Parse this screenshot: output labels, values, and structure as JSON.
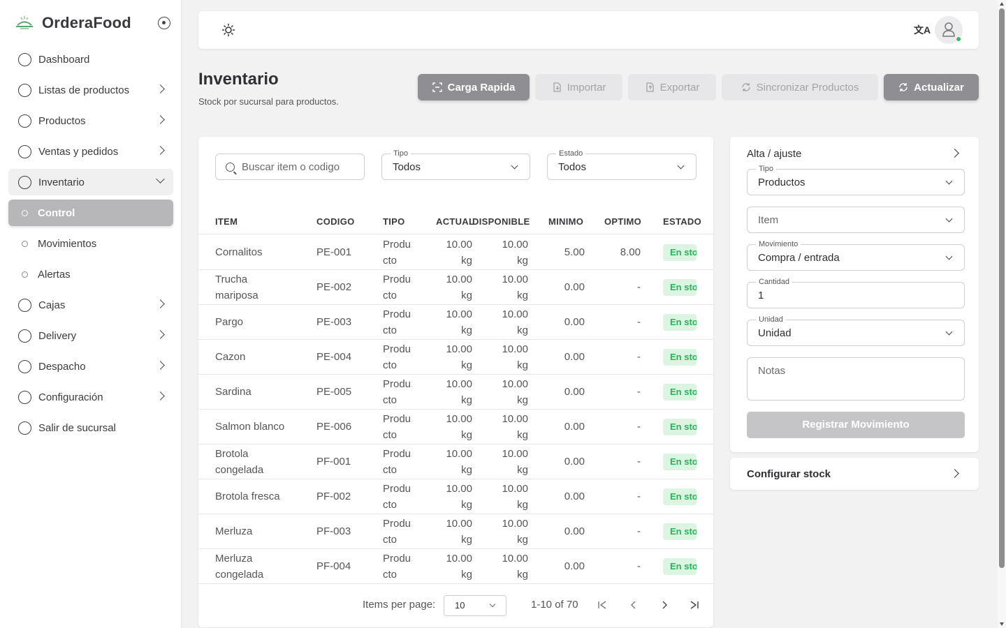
{
  "brand": {
    "name": "OrderaFood"
  },
  "sidebar": {
    "items": [
      {
        "label": "Dashboard",
        "kind": "ring",
        "chevron": "none"
      },
      {
        "label": "Listas de productos",
        "kind": "ring",
        "chevron": "right"
      },
      {
        "label": "Productos",
        "kind": "ring",
        "chevron": "right"
      },
      {
        "label": "Ventas y pedidos",
        "kind": "ring",
        "chevron": "right"
      },
      {
        "label": "Inventario",
        "kind": "ring",
        "chevron": "down",
        "state": "open"
      },
      {
        "label": "Control",
        "kind": "dot",
        "chevron": "none",
        "state": "active"
      },
      {
        "label": "Movimientos",
        "kind": "dot",
        "chevron": "none"
      },
      {
        "label": "Alertas",
        "kind": "dot",
        "chevron": "none"
      },
      {
        "label": "Cajas",
        "kind": "ring",
        "chevron": "right"
      },
      {
        "label": "Delivery",
        "kind": "ring",
        "chevron": "right"
      },
      {
        "label": "Despacho",
        "kind": "ring",
        "chevron": "right"
      },
      {
        "label": "Configuración",
        "kind": "ring",
        "chevron": "right"
      },
      {
        "label": "Salir de sucursal",
        "kind": "ring",
        "chevron": "none"
      }
    ]
  },
  "topbar": {
    "theme_icon": "sun-icon",
    "translate_label": "文A"
  },
  "page": {
    "title": "Inventario",
    "subtitle": "Stock por sucursal para productos."
  },
  "actions": {
    "carga_rapida": "Carga Rapida",
    "importar": "Importar",
    "exportar": "Exportar",
    "sincronizar": "Sincronizar Productos",
    "actualizar": "Actualizar"
  },
  "filters": {
    "search_placeholder": "Buscar item o codigo",
    "tipo_label": "Tipo",
    "tipo_value": "Todos",
    "estado_label": "Estado",
    "estado_value": "Todos"
  },
  "table": {
    "headers": [
      "ITEM",
      "CODIGO",
      "TIPO",
      "ACTUAL",
      "DISPONIBLE",
      "MINIMO",
      "OPTIMO",
      "ESTADO"
    ],
    "rows": [
      {
        "item": [
          "Cornalitos"
        ],
        "codigo": "PE-001",
        "tipo": [
          "Produ",
          "cto"
        ],
        "actual": [
          "10.00",
          "kg"
        ],
        "disponible": [
          "10.00",
          "kg"
        ],
        "minimo": "5.00",
        "optimo": "8.00",
        "estado": "En stock"
      },
      {
        "item": [
          "Trucha",
          "mariposa"
        ],
        "codigo": "PE-002",
        "tipo": [
          "Produ",
          "cto"
        ],
        "actual": [
          "10.00",
          "kg"
        ],
        "disponible": [
          "10.00",
          "kg"
        ],
        "minimo": "0.00",
        "optimo": "-",
        "estado": "En stock"
      },
      {
        "item": [
          "Pargo"
        ],
        "codigo": "PE-003",
        "tipo": [
          "Produ",
          "cto"
        ],
        "actual": [
          "10.00",
          "kg"
        ],
        "disponible": [
          "10.00",
          "kg"
        ],
        "minimo": "0.00",
        "optimo": "-",
        "estado": "En stock"
      },
      {
        "item": [
          "Cazon"
        ],
        "codigo": "PE-004",
        "tipo": [
          "Produ",
          "cto"
        ],
        "actual": [
          "10.00",
          "kg"
        ],
        "disponible": [
          "10.00",
          "kg"
        ],
        "minimo": "0.00",
        "optimo": "-",
        "estado": "En stock"
      },
      {
        "item": [
          "Sardina"
        ],
        "codigo": "PE-005",
        "tipo": [
          "Produ",
          "cto"
        ],
        "actual": [
          "10.00",
          "kg"
        ],
        "disponible": [
          "10.00",
          "kg"
        ],
        "minimo": "0.00",
        "optimo": "-",
        "estado": "En stock"
      },
      {
        "item": [
          "Salmon blanco"
        ],
        "codigo": "PE-006",
        "tipo": [
          "Produ",
          "cto"
        ],
        "actual": [
          "10.00",
          "kg"
        ],
        "disponible": [
          "10.00",
          "kg"
        ],
        "minimo": "0.00",
        "optimo": "-",
        "estado": "En stock"
      },
      {
        "item": [
          "Brotola",
          "congelada"
        ],
        "codigo": "PF-001",
        "tipo": [
          "Produ",
          "cto"
        ],
        "actual": [
          "10.00",
          "kg"
        ],
        "disponible": [
          "10.00",
          "kg"
        ],
        "minimo": "0.00",
        "optimo": "-",
        "estado": "En stock"
      },
      {
        "item": [
          "Brotola fresca"
        ],
        "codigo": "PF-002",
        "tipo": [
          "Produ",
          "cto"
        ],
        "actual": [
          "10.00",
          "kg"
        ],
        "disponible": [
          "10.00",
          "kg"
        ],
        "minimo": "0.00",
        "optimo": "-",
        "estado": "En stock"
      },
      {
        "item": [
          "Merluza"
        ],
        "codigo": "PF-003",
        "tipo": [
          "Produ",
          "cto"
        ],
        "actual": [
          "10.00",
          "kg"
        ],
        "disponible": [
          "10.00",
          "kg"
        ],
        "minimo": "0.00",
        "optimo": "-",
        "estado": "En stock"
      },
      {
        "item": [
          "Merluza",
          "congelada"
        ],
        "codigo": "PF-004",
        "tipo": [
          "Produ",
          "cto"
        ],
        "actual": [
          "10.00",
          "kg"
        ],
        "disponible": [
          "10.00",
          "kg"
        ],
        "minimo": "0.00",
        "optimo": "-",
        "estado": "En stock"
      }
    ]
  },
  "pagination": {
    "items_per_page_label": "Items per page:",
    "items_per_page_value": "10",
    "range": "1-10 of 70"
  },
  "form": {
    "title": "Alta / ajuste",
    "tipo_label": "Tipo",
    "tipo_value": "Productos",
    "item_placeholder": "Item",
    "movimiento_label": "Movimiento",
    "movimiento_value": "Compra / entrada",
    "cantidad_label": "Cantidad",
    "cantidad_value": "1",
    "unidad_label": "Unidad",
    "unidad_value": "Unidad",
    "notas_placeholder": "Notas",
    "submit_label": "Registrar Movimiento"
  },
  "config": {
    "title": "Configurar stock"
  },
  "colors": {
    "badge_bg": "#dcf5e3",
    "badge_text": "#2bb05a",
    "online": "#2fbf5f",
    "primary_btn": "#8f8f93"
  }
}
